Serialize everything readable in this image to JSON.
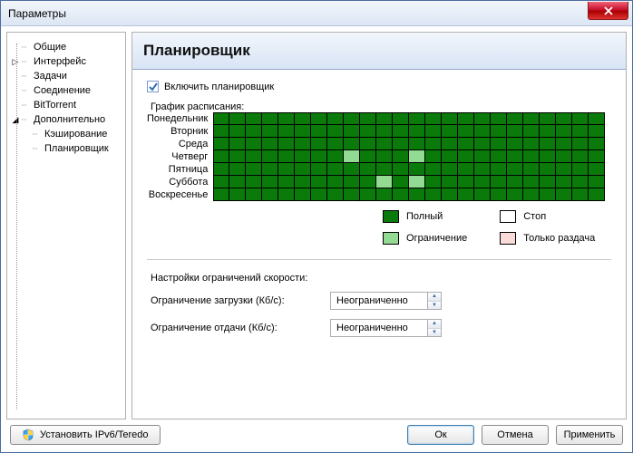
{
  "window": {
    "title": "Параметры"
  },
  "tree": {
    "items": [
      {
        "label": "Общие",
        "expand": ""
      },
      {
        "label": "Интерфейс",
        "expand": "▷"
      },
      {
        "label": "Задачи",
        "expand": ""
      },
      {
        "label": "Соединение",
        "expand": ""
      },
      {
        "label": "BitTorrent",
        "expand": ""
      },
      {
        "label": "Дополнительно",
        "expand": "◢"
      },
      {
        "label": "Кэширование",
        "expand": "",
        "child": true
      },
      {
        "label": "Планировщик",
        "expand": "",
        "child": true
      }
    ]
  },
  "header": {
    "title": "Планировщик"
  },
  "enable": {
    "label": "Включить планировщик",
    "checked": true
  },
  "schedule": {
    "caption": "График расписания:",
    "days": [
      "Понедельник",
      "Вторник",
      "Среда",
      "Четверг",
      "Пятница",
      "Суббота",
      "Воскресенье"
    ],
    "cols": 24,
    "limited_cells": [
      {
        "day": 3,
        "hours": [
          8,
          12
        ]
      },
      {
        "day": 5,
        "hours": [
          10,
          12
        ]
      }
    ]
  },
  "legend": {
    "full": "Полный",
    "stop": "Стоп",
    "limited": "Ограничение",
    "seed": "Только раздача"
  },
  "limits": {
    "caption": "Настройки ограничений скорости:",
    "download_label": "Ограничение загрузки (Кб/с):",
    "upload_label": "Ограничение отдачи (Кб/с):",
    "download_value": "Неограниченно",
    "upload_value": "Неограниченно"
  },
  "footer": {
    "install": "Установить IPv6/Teredo",
    "ok": "Ок",
    "cancel": "Отмена",
    "apply": "Применить"
  }
}
